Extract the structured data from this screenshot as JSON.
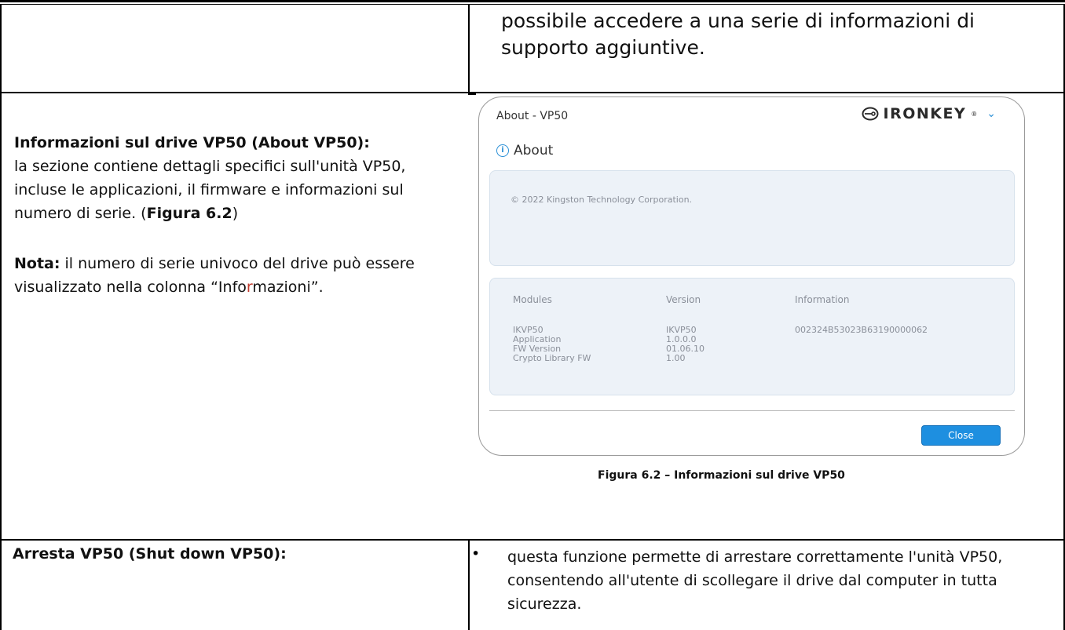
{
  "row1": {
    "text_line1": "possibile accedere a una serie di informazioni di",
    "text_line2": "supporto aggiuntive."
  },
  "row2": {
    "heading": "Informazioni sul drive VP50 (About VP50):",
    "desc_before_bold": "la sezione contiene dettagli specifici sull'unità VP50, incluse le applicazioni, il firmware e informazioni sul numero di serie. (",
    "desc_bold": "Figura 6.2",
    "desc_after_bold": ")",
    "note_label": "Nota:",
    "note_text_1": " il numero di serie univoco del drive può essere visualizzato nella colonna “Info",
    "note_text_red": "r",
    "note_text_2": "mazioni”."
  },
  "dialog": {
    "title": "About - VP50",
    "brand": "IRONKEY",
    "brand_trademark": "®",
    "menu_icon": "chevron-down-icon",
    "section_title": "About",
    "section_icon": "info-icon",
    "copyright": "© 2022 Kingston Technology Corporation.",
    "columns": [
      "Modules",
      "Version",
      "Information"
    ],
    "rows": [
      {
        "module": "IKVP50",
        "version": "IKVP50",
        "info": "002324B53023B63190000062"
      },
      {
        "module": "Application",
        "version": "1.0.0.0",
        "info": ""
      },
      {
        "module": "FW Version",
        "version": "01.06.10",
        "info": ""
      },
      {
        "module": "Crypto Library FW",
        "version": "1.00",
        "info": ""
      }
    ],
    "close_label": "Close",
    "accent_color": "#1e8fe0"
  },
  "caption": "Figura 6.2 – Informazioni sul drive VP50",
  "row3": {
    "heading": "Arresta VP50 (Shut down VP50):",
    "bullet": "•",
    "text": "questa funzione permette di arrestare correttamente l'unità VP50, consentendo all'utente di scollegare il drive dal computer in tutta sicurezza."
  }
}
